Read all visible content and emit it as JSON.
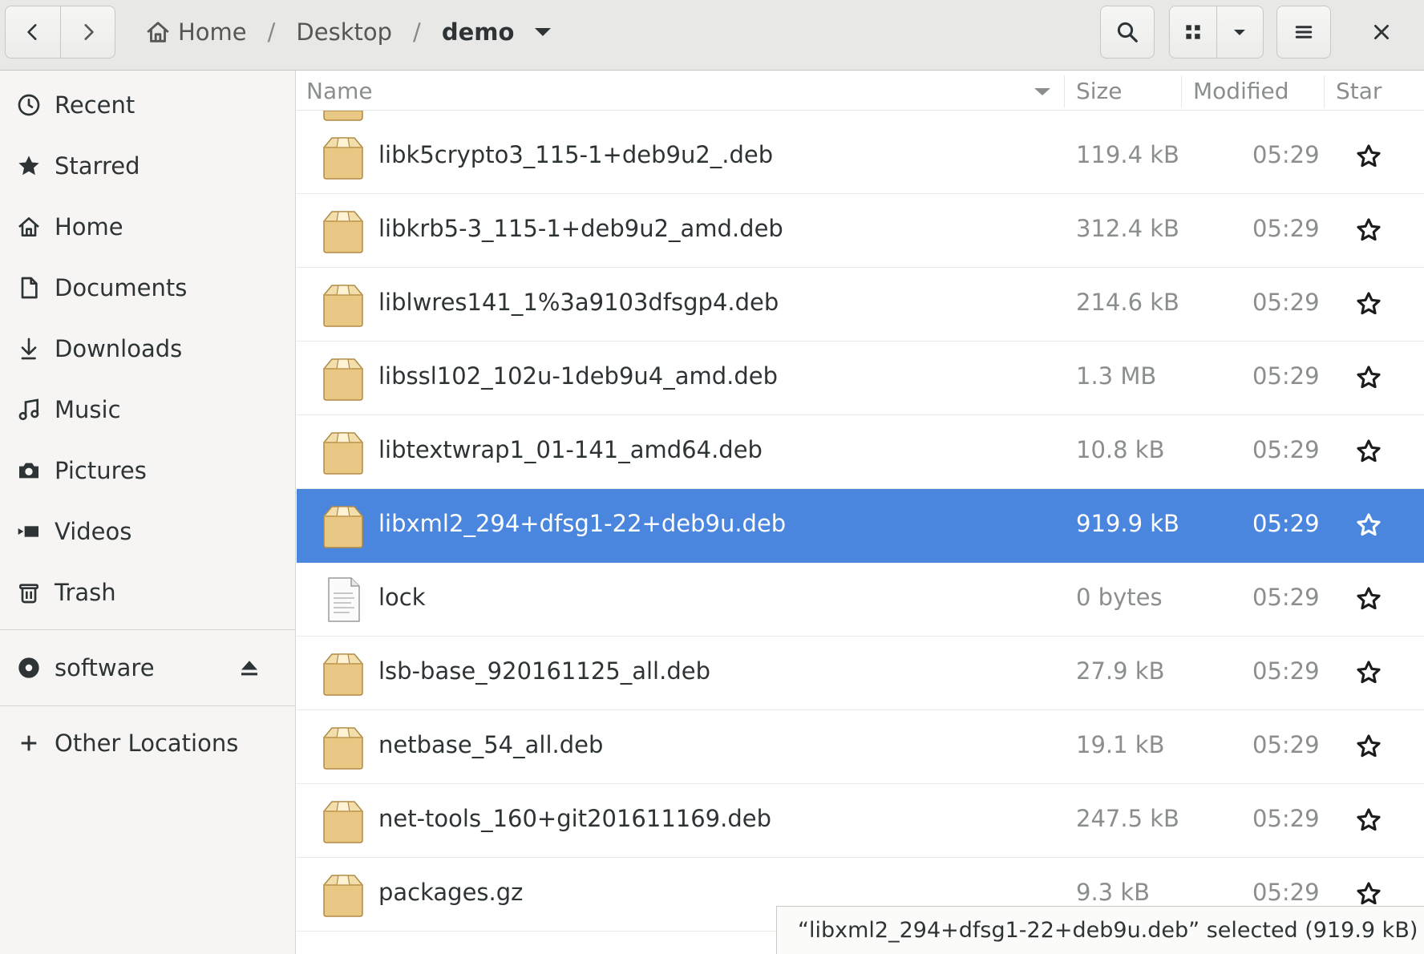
{
  "header": {
    "breadcrumbs": [
      "Home",
      "Desktop",
      "demo"
    ],
    "separator": "/"
  },
  "sidebar": {
    "places": [
      {
        "label": "Recent",
        "icon": "clock-icon"
      },
      {
        "label": "Starred",
        "icon": "star-icon"
      },
      {
        "label": "Home",
        "icon": "home-icon"
      },
      {
        "label": "Documents",
        "icon": "document-icon"
      },
      {
        "label": "Downloads",
        "icon": "download-icon"
      },
      {
        "label": "Music",
        "icon": "music-icon"
      },
      {
        "label": "Pictures",
        "icon": "camera-icon"
      },
      {
        "label": "Videos",
        "icon": "video-icon"
      },
      {
        "label": "Trash",
        "icon": "trash-icon"
      }
    ],
    "devices": [
      {
        "label": "software",
        "icon": "disc-icon"
      }
    ],
    "other": {
      "label": "Other Locations",
      "icon": "plus-icon"
    }
  },
  "columns": {
    "name": "Name",
    "size": "Size",
    "modified": "Modified",
    "star": "Star"
  },
  "files": [
    {
      "name": "libk5crypto3_115-1+deb9u2_.deb",
      "size": "119.4 kB",
      "modified": "05:29",
      "type": "package",
      "selected": false
    },
    {
      "name": "libkrb5-3_115-1+deb9u2_amd.deb",
      "size": "312.4 kB",
      "modified": "05:29",
      "type": "package",
      "selected": false
    },
    {
      "name": "liblwres141_1%3a9103dfsgp4.deb",
      "size": "214.6 kB",
      "modified": "05:29",
      "type": "package",
      "selected": false
    },
    {
      "name": "libssl102_102u-1deb9u4_amd.deb",
      "size": "1.3 MB",
      "modified": "05:29",
      "type": "package",
      "selected": false
    },
    {
      "name": "libtextwrap1_01-141_amd64.deb",
      "size": "10.8 kB",
      "modified": "05:29",
      "type": "package",
      "selected": false
    },
    {
      "name": "libxml2_294+dfsg1-22+deb9u.deb",
      "size": "919.9 kB",
      "modified": "05:29",
      "type": "package",
      "selected": true
    },
    {
      "name": "lock",
      "size": "0 bytes",
      "modified": "05:29",
      "type": "text",
      "selected": false
    },
    {
      "name": "lsb-base_920161125_all.deb",
      "size": "27.9 kB",
      "modified": "05:29",
      "type": "package",
      "selected": false
    },
    {
      "name": "netbase_54_all.deb",
      "size": "19.1 kB",
      "modified": "05:29",
      "type": "package",
      "selected": false
    },
    {
      "name": "net-tools_160+git201611169.deb",
      "size": "247.5 kB",
      "modified": "05:29",
      "type": "package",
      "selected": false
    },
    {
      "name": "packages.gz",
      "size": "9.3 kB",
      "modified": "05:29",
      "type": "package",
      "selected": false
    }
  ],
  "status": {
    "text": "“libxml2_294+dfsg1-22+deb9u.deb” selected  (919.9 kB)"
  },
  "colors": {
    "selection": "#4a86dd",
    "header_bg": "#e8e8e7",
    "sidebar_bg": "#f6f5f4"
  }
}
